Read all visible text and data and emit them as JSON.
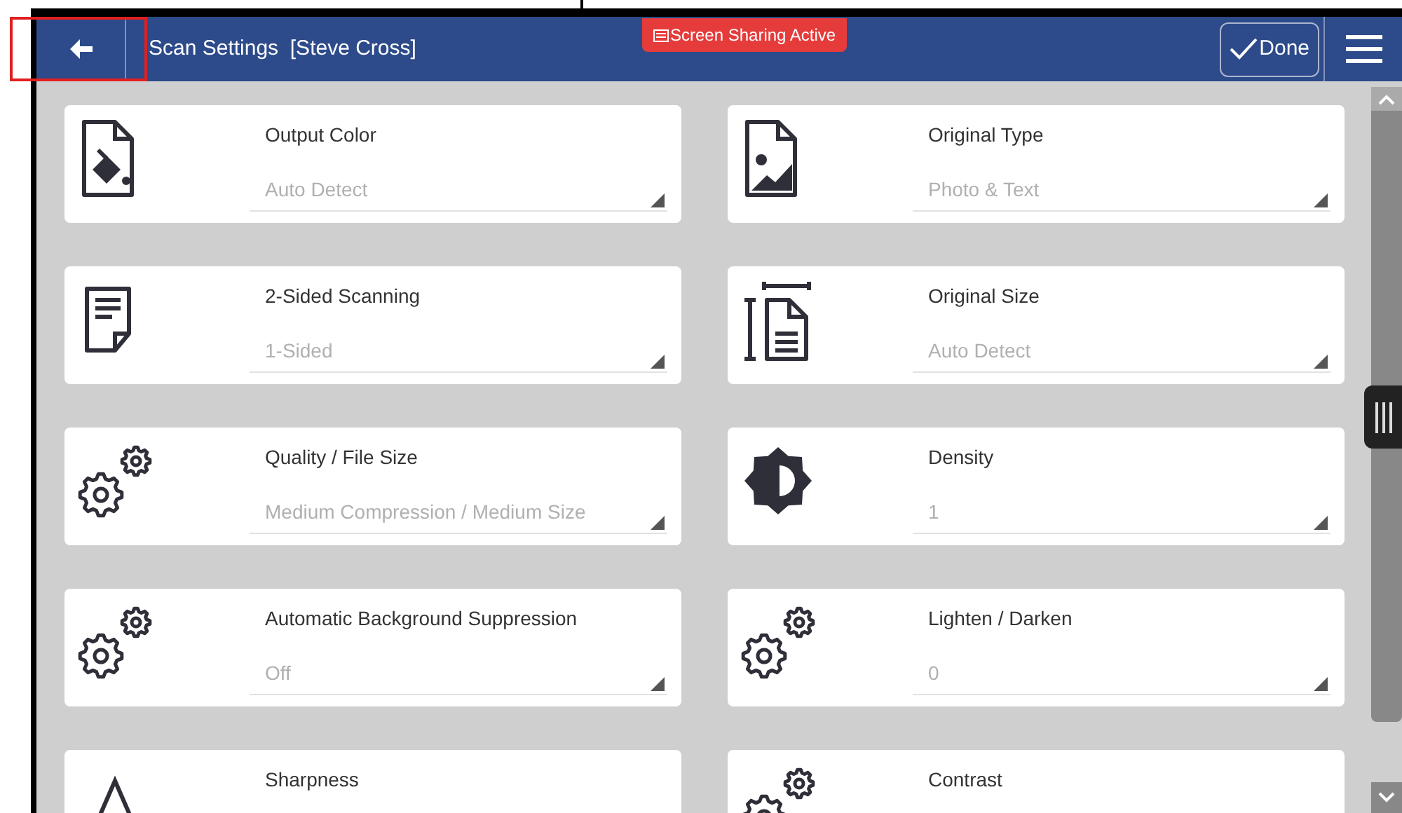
{
  "header": {
    "title": "Scan Settings  [Steve Cross]",
    "badge": "Screen Sharing Active",
    "done_button": "Done"
  },
  "settings": [
    {
      "kind": "color",
      "label": "Output Color",
      "value": "Auto Detect"
    },
    {
      "kind": "image",
      "label": "Original Type",
      "value": "Photo & Text"
    },
    {
      "kind": "sides",
      "label": "2-Sided Scanning",
      "value": "1-Sided"
    },
    {
      "kind": "size",
      "label": "Original Size",
      "value": "Auto Detect"
    },
    {
      "kind": "gears",
      "label": "Quality / File Size",
      "value": "Medium Compression / Medium Size"
    },
    {
      "kind": "density",
      "label": "Density",
      "value": "1"
    },
    {
      "kind": "gears",
      "label": "Automatic Background Suppression",
      "value": "Off"
    },
    {
      "kind": "gears",
      "label": "Lighten / Darken",
      "value": "0"
    },
    {
      "kind": "sharpness",
      "label": "Sharpness"
    },
    {
      "kind": "gears",
      "label": "Contrast"
    }
  ]
}
